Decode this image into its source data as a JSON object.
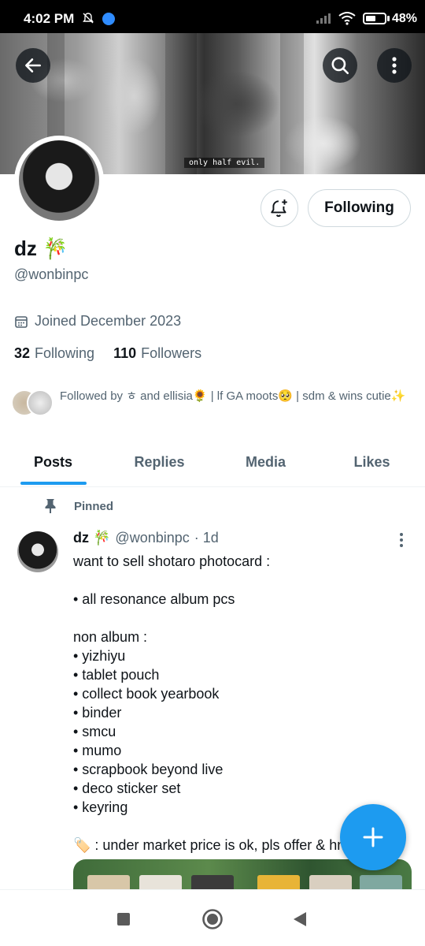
{
  "status_bar": {
    "time": "4:02 PM",
    "battery": "48%",
    "icons": [
      "mute-icon",
      "messenger-icon",
      "signal-icon",
      "wifi-icon",
      "battery-icon"
    ]
  },
  "banner": {
    "caption": "only half evil."
  },
  "profile": {
    "display_name": "dz 🎋",
    "username": "@wonbinpc",
    "joined": "Joined December 2023",
    "following_count": "32",
    "following_label": "Following",
    "followers_count": "110",
    "followers_label": "Followers",
    "followed_by": "Followed by ㅎ and ellisia🌻 | lf GA moots🥺 | sdm & wins cutie✨",
    "follow_button": "Following"
  },
  "tabs": [
    {
      "label": "Posts",
      "active": true
    },
    {
      "label": "Replies",
      "active": false
    },
    {
      "label": "Media",
      "active": false
    },
    {
      "label": "Likes",
      "active": false
    }
  ],
  "post": {
    "pinned_label": "Pinned",
    "name": "dz 🎋",
    "handle": "@wonbinpc",
    "time": "· 1d",
    "body": "want to sell shotaro photocard :\n\n• all resonance album pcs\n\nnon album :\n• yizhiyu\n• tablet pouch\n• collect book yearbook\n• binder\n• smcu\n• mumo\n• scrapbook beyond live\n• deco sticker set\n• keyring\n\n🏷️ : under market price is ok, pls offer & hmu"
  },
  "colors": {
    "accent": "#1d9bf0",
    "text_primary": "#0f1419",
    "text_secondary": "#536471",
    "border": "#cfd9de"
  }
}
